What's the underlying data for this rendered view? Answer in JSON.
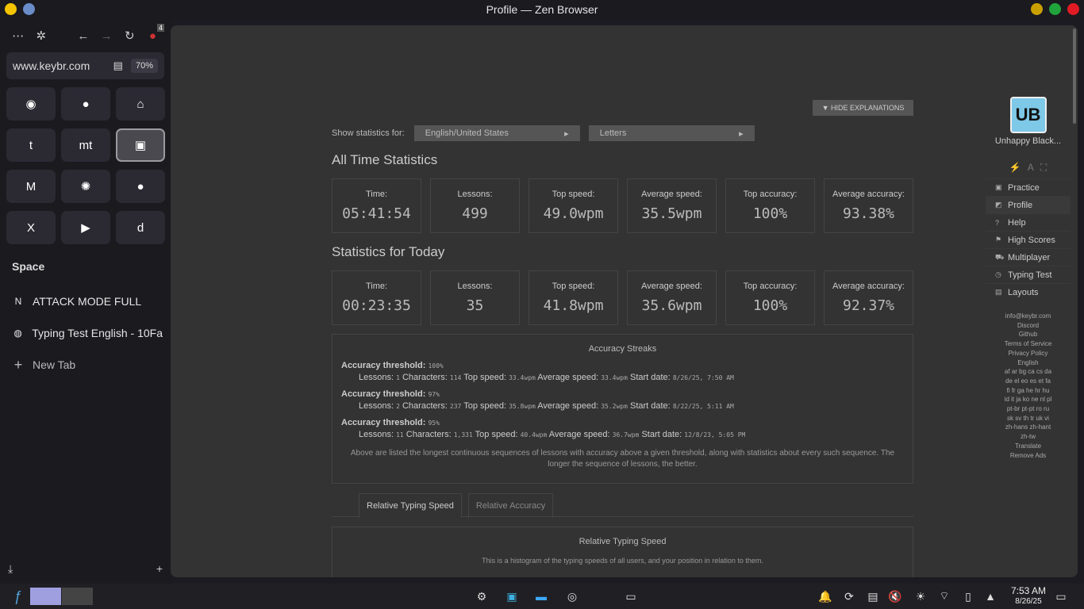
{
  "window": {
    "title": "Profile — Zen Browser"
  },
  "sidebar": {
    "url": "www.keybr.com",
    "zoom": "70%",
    "badge": "4",
    "space_label": "Space",
    "tabs": [
      {
        "label": "ATTACK MODE FULL"
      },
      {
        "label": "Typing Test English - 10Fa"
      }
    ],
    "new_tab": "New Tab",
    "tiles": [
      {
        "icon": "discord-icon",
        "glyph": "◉"
      },
      {
        "icon": "github-icon",
        "glyph": "●"
      },
      {
        "icon": "home-icon",
        "glyph": "⌂"
      },
      {
        "icon": "tumblr-icon",
        "glyph": "t"
      },
      {
        "icon": "monkeytype-icon",
        "glyph": "mt"
      },
      {
        "icon": "keybr-icon",
        "glyph": "▣"
      },
      {
        "icon": "gmail-icon",
        "glyph": "M"
      },
      {
        "icon": "openai-icon",
        "glyph": "✺"
      },
      {
        "icon": "reddit-icon",
        "glyph": "●"
      },
      {
        "icon": "x-icon",
        "glyph": "X"
      },
      {
        "icon": "youtube-icon",
        "glyph": "▶"
      },
      {
        "icon": "deezer-icon",
        "glyph": "d"
      }
    ]
  },
  "page": {
    "hide_btn": "▼ HIDE EXPLANATIONS",
    "show_label": "Show statistics for:",
    "layout_select": "English/United States",
    "mode_select": "Letters",
    "all_time_title": "All Time Statistics",
    "today_title": "Statistics for Today",
    "all_time": [
      {
        "label": "Time:",
        "value": "05:41:54"
      },
      {
        "label": "Lessons:",
        "value": "499"
      },
      {
        "label": "Top speed:",
        "value": "49.0wpm"
      },
      {
        "label": "Average speed:",
        "value": "35.5wpm"
      },
      {
        "label": "Top accuracy:",
        "value": "100%"
      },
      {
        "label": "Average accuracy:",
        "value": "93.38%"
      }
    ],
    "today": [
      {
        "label": "Time:",
        "value": "00:23:35"
      },
      {
        "label": "Lessons:",
        "value": "35"
      },
      {
        "label": "Top speed:",
        "value": "41.8wpm"
      },
      {
        "label": "Average speed:",
        "value": "35.6wpm"
      },
      {
        "label": "Top accuracy:",
        "value": "100%"
      },
      {
        "label": "Average accuracy:",
        "value": "92.37%"
      }
    ],
    "streaks_title": "Accuracy Streaks",
    "threshold_label": "Accuracy threshold:",
    "lessons_label": "Lessons:",
    "chars_label": "Characters:",
    "top_label": "Top speed:",
    "avg_label": "Average speed:",
    "start_label": "Start date:",
    "streaks": [
      {
        "threshold": "100%",
        "lessons": "1",
        "chars": "114",
        "top": "33.4wpm",
        "avg": "33.4wpm",
        "date": "8/26/25, 7:50 AM"
      },
      {
        "threshold": "97%",
        "lessons": "2",
        "chars": "237",
        "top": "35.8wpm",
        "avg": "35.2wpm",
        "date": "8/22/25, 5:11 AM"
      },
      {
        "threshold": "95%",
        "lessons": "11",
        "chars": "1,331",
        "top": "40.4wpm",
        "avg": "36.7wpm",
        "date": "12/8/23, 5:05 PM"
      }
    ],
    "streaks_note": "Above are listed the longest continuous sequences of lessons with accuracy above a given threshold, along with statistics about every such sequence. The longer the sequence of lessons, the better.",
    "tab1": "Relative Typing Speed",
    "tab2": "Relative Accuracy",
    "hist_title": "Relative Typing Speed",
    "hist_desc": "This is a histogram of the typing speeds of all users, and your position in relation to them."
  },
  "right": {
    "avatar": "UB",
    "username": "Unhappy Black...",
    "menu": [
      "Practice",
      "Profile",
      "Help",
      "High Scores",
      "Multiplayer",
      "Typing Test",
      "Layouts"
    ],
    "links": [
      "info@keybr.com",
      "Discord",
      "Github",
      "Terms of Service",
      "Privacy Policy",
      "English",
      "af ar bg ca cs da",
      "de el eo es et fa",
      "fi fr ga he hr hu",
      "id it ja ko ne nl pl",
      "pt-br pt-pt ro ru",
      "sk sv th tr uk vi",
      "zh-hans zh-hant",
      "zh-tw",
      "Translate",
      "Remove Ads"
    ]
  },
  "taskbar": {
    "time": "7:53 AM",
    "date": "8/26/25"
  }
}
